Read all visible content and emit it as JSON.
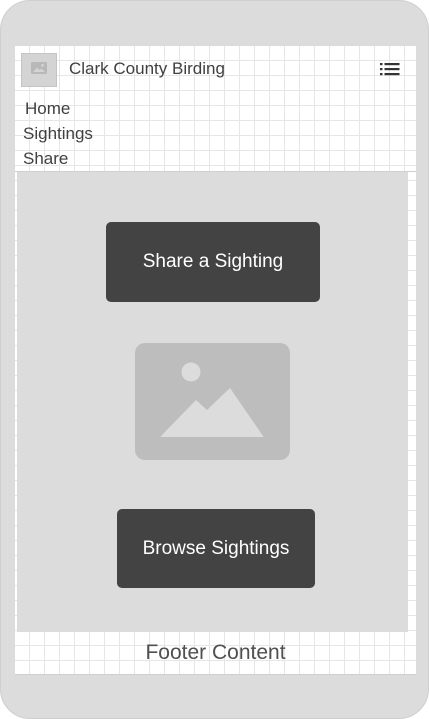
{
  "header": {
    "title": "Clark County Birding",
    "logo_icon": "image-placeholder-icon",
    "menu_icon": "list-menu-icon"
  },
  "nav": {
    "items": [
      {
        "label": "Home"
      },
      {
        "label": "Sightings"
      },
      {
        "label": "Share"
      }
    ]
  },
  "main": {
    "share_button_label": "Share a Sighting",
    "image_icon": "image-placeholder-icon",
    "browse_button_label": "Browse Sightings"
  },
  "footer": {
    "text": "Footer Content"
  },
  "colors": {
    "frame": "#dcdcdc",
    "content_background": "#dcdcdc",
    "button_background": "#434343",
    "button_text": "#ffffff",
    "placeholder_fill": "#bdbdbd",
    "text": "#404040"
  }
}
